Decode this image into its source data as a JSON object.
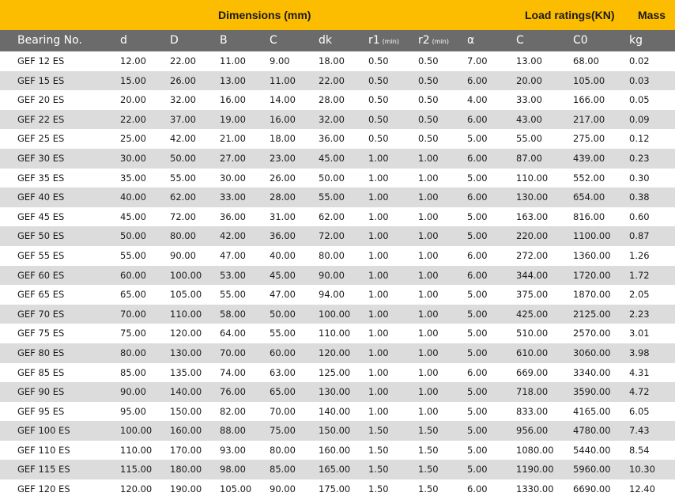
{
  "group_header": {
    "dimensions": "Dimensions (mm)",
    "load_ratings": "Load ratings(KN)",
    "mass": "Mass"
  },
  "columns": [
    {
      "label": "Bearing No.",
      "sub": ""
    },
    {
      "label": "d",
      "sub": ""
    },
    {
      "label": "D",
      "sub": ""
    },
    {
      "label": "B",
      "sub": ""
    },
    {
      "label": "C",
      "sub": ""
    },
    {
      "label": "dk",
      "sub": ""
    },
    {
      "label": "r1",
      "sub": "(min)"
    },
    {
      "label": "r2",
      "sub": "(min)"
    },
    {
      "label": "α",
      "sub": ""
    },
    {
      "label": "C",
      "sub": ""
    },
    {
      "label": "C0",
      "sub": ""
    },
    {
      "label": "kg",
      "sub": ""
    }
  ],
  "rows": [
    [
      "GEF 12 ES",
      "12.00",
      "22.00",
      "11.00",
      "9.00",
      "18.00",
      "0.50",
      "0.50",
      "7.00",
      "13.00",
      "68.00",
      "0.02"
    ],
    [
      "GEF 15 ES",
      "15.00",
      "26.00",
      "13.00",
      "11.00",
      "22.00",
      "0.50",
      "0.50",
      "6.00",
      "20.00",
      "105.00",
      "0.03"
    ],
    [
      "GEF 20 ES",
      "20.00",
      "32.00",
      "16.00",
      "14.00",
      "28.00",
      "0.50",
      "0.50",
      "4.00",
      "33.00",
      "166.00",
      "0.05"
    ],
    [
      "GEF 22 ES",
      "22.00",
      "37.00",
      "19.00",
      "16.00",
      "32.00",
      "0.50",
      "0.50",
      "6.00",
      "43.00",
      "217.00",
      "0.09"
    ],
    [
      "GEF 25 ES",
      "25.00",
      "42.00",
      "21.00",
      "18.00",
      "36.00",
      "0.50",
      "0.50",
      "5.00",
      "55.00",
      "275.00",
      "0.12"
    ],
    [
      "GEF 30 ES",
      "30.00",
      "50.00",
      "27.00",
      "23.00",
      "45.00",
      "1.00",
      "1.00",
      "6.00",
      "87.00",
      "439.00",
      "0.23"
    ],
    [
      "GEF 35 ES",
      "35.00",
      "55.00",
      "30.00",
      "26.00",
      "50.00",
      "1.00",
      "1.00",
      "5.00",
      "110.00",
      "552.00",
      "0.30"
    ],
    [
      "GEF 40 ES",
      "40.00",
      "62.00",
      "33.00",
      "28.00",
      "55.00",
      "1.00",
      "1.00",
      "6.00",
      "130.00",
      "654.00",
      "0.38"
    ],
    [
      "GEF 45 ES",
      "45.00",
      "72.00",
      "36.00",
      "31.00",
      "62.00",
      "1.00",
      "1.00",
      "5.00",
      "163.00",
      "816.00",
      "0.60"
    ],
    [
      "GEF 50 ES",
      "50.00",
      "80.00",
      "42.00",
      "36.00",
      "72.00",
      "1.00",
      "1.00",
      "5.00",
      "220.00",
      "1100.00",
      "0.87"
    ],
    [
      "GEF 55 ES",
      "55.00",
      "90.00",
      "47.00",
      "40.00",
      "80.00",
      "1.00",
      "1.00",
      "6.00",
      "272.00",
      "1360.00",
      "1.26"
    ],
    [
      "GEF 60 ES",
      "60.00",
      "100.00",
      "53.00",
      "45.00",
      "90.00",
      "1.00",
      "1.00",
      "6.00",
      "344.00",
      "1720.00",
      "1.72"
    ],
    [
      "GEF 65 ES",
      "65.00",
      "105.00",
      "55.00",
      "47.00",
      "94.00",
      "1.00",
      "1.00",
      "5.00",
      "375.00",
      "1870.00",
      "2.05"
    ],
    [
      "GEF 70 ES",
      "70.00",
      "110.00",
      "58.00",
      "50.00",
      "100.00",
      "1.00",
      "1.00",
      "5.00",
      "425.00",
      "2125.00",
      "2.23"
    ],
    [
      "GEF 75 ES",
      "75.00",
      "120.00",
      "64.00",
      "55.00",
      "110.00",
      "1.00",
      "1.00",
      "5.00",
      "510.00",
      "2570.00",
      "3.01"
    ],
    [
      "GEF 80 ES",
      "80.00",
      "130.00",
      "70.00",
      "60.00",
      "120.00",
      "1.00",
      "1.00",
      "5.00",
      "610.00",
      "3060.00",
      "3.98"
    ],
    [
      "GEF 85 ES",
      "85.00",
      "135.00",
      "74.00",
      "63.00",
      "125.00",
      "1.00",
      "1.00",
      "6.00",
      "669.00",
      "3340.00",
      "4.31"
    ],
    [
      "GEF 90 ES",
      "90.00",
      "140.00",
      "76.00",
      "65.00",
      "130.00",
      "1.00",
      "1.00",
      "5.00",
      "718.00",
      "3590.00",
      "4.72"
    ],
    [
      "GEF 95 ES",
      "95.00",
      "150.00",
      "82.00",
      "70.00",
      "140.00",
      "1.00",
      "1.00",
      "5.00",
      "833.00",
      "4165.00",
      "6.05"
    ],
    [
      "GEF 100 ES",
      "100.00",
      "160.00",
      "88.00",
      "75.00",
      "150.00",
      "1.50",
      "1.50",
      "5.00",
      "956.00",
      "4780.00",
      "7.43"
    ],
    [
      "GEF 110 ES",
      "110.00",
      "170.00",
      "93.00",
      "80.00",
      "160.00",
      "1.50",
      "1.50",
      "5.00",
      "1080.00",
      "5440.00",
      "8.54"
    ],
    [
      "GEF 115 ES",
      "115.00",
      "180.00",
      "98.00",
      "85.00",
      "165.00",
      "1.50",
      "1.50",
      "5.00",
      "1190.00",
      "5960.00",
      "10.30"
    ],
    [
      "GEF 120 ES",
      "120.00",
      "190.00",
      "105.00",
      "90.00",
      "175.00",
      "1.50",
      "1.50",
      "6.00",
      "1330.00",
      "6690.00",
      "12.40"
    ]
  ]
}
